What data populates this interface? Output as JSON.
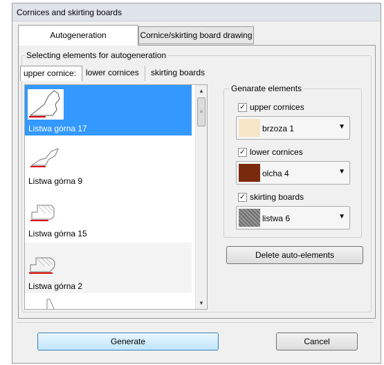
{
  "window": {
    "title": "Cornices and skirting boards"
  },
  "tabs": [
    {
      "label": "Autogeneration"
    },
    {
      "label": "Cornice/skirting board drawing"
    }
  ],
  "group_selecting": {
    "label": "Selecting elements for autogeneration"
  },
  "subtabs": [
    {
      "label": "upper cornice:"
    },
    {
      "label": "lower cornices"
    },
    {
      "label": "skirting boards"
    }
  ],
  "list_items": [
    {
      "label": "Listwa górna 17",
      "selected": true
    },
    {
      "label": "Listwa górna 9",
      "selected": false
    },
    {
      "label": "Listwa górna 15",
      "selected": false
    },
    {
      "label": "Listwa górna 2",
      "selected": false
    }
  ],
  "generate_elements": {
    "label": "Genarate elements",
    "upper": {
      "label": "upper cornices",
      "checked": true,
      "value": "brzoza 1",
      "color": "#f5e6c8"
    },
    "lower": {
      "label": "lower cornices",
      "checked": true,
      "value": "olcha 4",
      "color": "#7a2a0c"
    },
    "skirting": {
      "label": "skirting boards",
      "checked": true,
      "value": "listwa 6",
      "color": "#8c8c8c"
    }
  },
  "delete_button": {
    "label": "Delete auto-elements"
  },
  "footer": {
    "generate_label": "Generate",
    "cancel_label": "Cancel"
  },
  "icons": {
    "check": "✓",
    "dropdown": "▼",
    "scroll_up": "▲",
    "scroll_down": "▼",
    "grip": "≡"
  }
}
